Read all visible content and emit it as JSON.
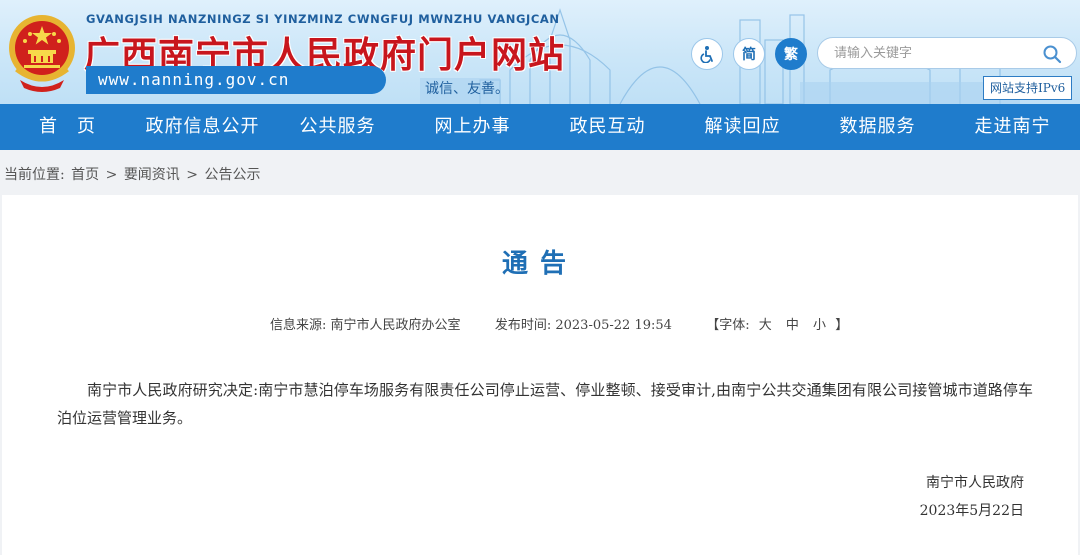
{
  "header": {
    "en_title": "GVANGJSIH NANZNINGZ SI YINZMINZ CWNGFUJ MWNZHU VANGJCAN",
    "cn_title": "广西南宁市人民政府门户网站",
    "url": "www.nanning.gov.cn",
    "slogan": "诚信、友善。",
    "simplified_label": "简",
    "traditional_label": "繁",
    "search_placeholder": "请输入关键字",
    "ipv6_label": "网站支持IPv6"
  },
  "nav": {
    "items": [
      "首　页",
      "政府信息公开",
      "公共服务",
      "网上办事",
      "政民互动",
      "解读回应",
      "数据服务",
      "走进南宁"
    ]
  },
  "breadcrumb": {
    "prefix": "当前位置:",
    "items": [
      "首页",
      "要闻资讯",
      "公告公示"
    ],
    "separator": ">"
  },
  "article": {
    "title": "通告",
    "source_label": "信息来源:",
    "source": "南宁市人民政府办公室",
    "date_label": "发布时间:",
    "date": "2023-05-22 19:54",
    "font_label": "【字体:",
    "font_large": "大",
    "font_medium": "中",
    "font_small": "小",
    "font_close": "】",
    "body": "南宁市人民政府研究决定:南宁市慧泊停车场服务有限责任公司停止运营、停业整顿、接受审计,由南宁公共交通集团有限公司接管城市道路停车泊位运营管理业务。",
    "signature_org": "南宁市人民政府",
    "signature_date": "2023年5月22日"
  },
  "colors": {
    "primary_blue": "#1f7ccc",
    "title_red": "#c8161d",
    "title_blue": "#1f6fb5"
  }
}
